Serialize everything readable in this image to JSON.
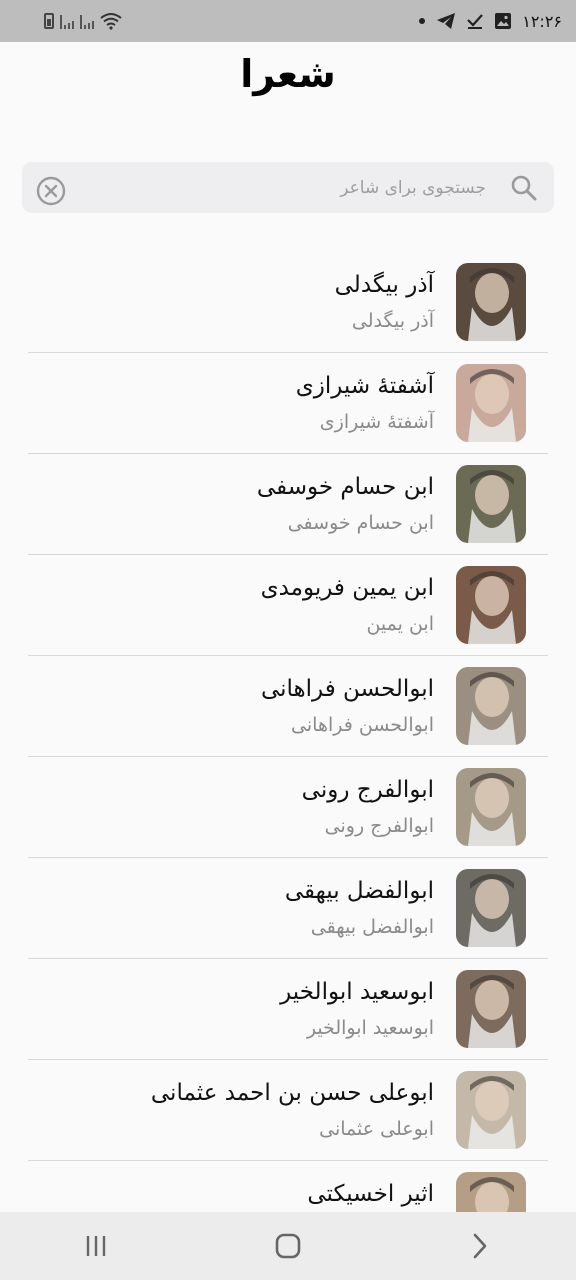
{
  "status_bar": {
    "time": "۱۲:۲۶"
  },
  "header": {
    "title": "شعرا"
  },
  "search": {
    "placeholder": "جستجوی برای شاعر",
    "value": ""
  },
  "poets": [
    {
      "name": "آذر بیگدلی",
      "subtitle": "آذر بیگدلی",
      "avatar_color": "#5a4b3f"
    },
    {
      "name": "آشفتهٔ شیرازی",
      "subtitle": "آشفتهٔ شیرازی",
      "avatar_color": "#c9a99c"
    },
    {
      "name": "ابن حسام خوسفی",
      "subtitle": "ابن حسام خوسفی",
      "avatar_color": "#6b6a55"
    },
    {
      "name": "ابن یمین فریومدی",
      "subtitle": "ابن یمین",
      "avatar_color": "#7a5a48"
    },
    {
      "name": "ابوالحسن فراهانی",
      "subtitle": "ابوالحسن فراهانی",
      "avatar_color": "#9a8f80"
    },
    {
      "name": "ابوالفرج رونی",
      "subtitle": "ابوالفرج رونی",
      "avatar_color": "#a59a88"
    },
    {
      "name": "ابوالفضل بیهقی",
      "subtitle": "ابوالفضل بیهقی",
      "avatar_color": "#6e6a64"
    },
    {
      "name": "ابوسعید ابوالخیر",
      "subtitle": "ابوسعید ابوالخیر",
      "avatar_color": "#7d6c5e"
    },
    {
      "name": "ابوعلی حسن بن احمد عثمانی",
      "subtitle": "ابوعلی عثمانی",
      "avatar_color": "#c4b9a8"
    },
    {
      "name": "اثیر اخسیکتی",
      "subtitle": "",
      "avatar_color": "#b59e86"
    }
  ],
  "colors": {
    "status_bar_bg": "#bdbdbd",
    "background": "#fafafa",
    "search_bg": "#eeeef0",
    "divider": "#d9d9d9",
    "subtitle_text": "#8a8a8a"
  }
}
